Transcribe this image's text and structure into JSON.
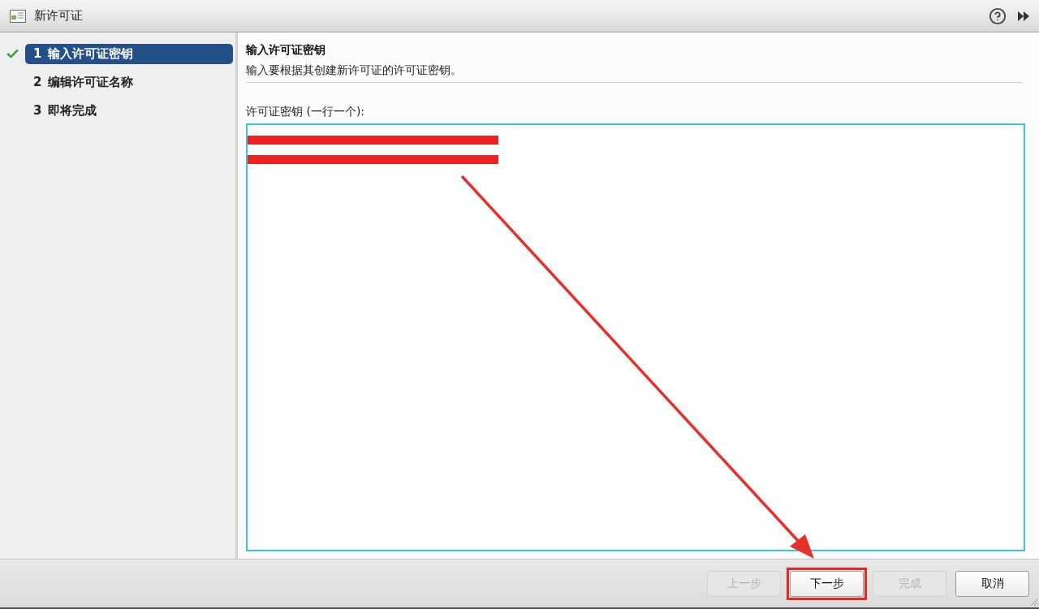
{
  "window": {
    "title": "新许可证"
  },
  "steps": [
    {
      "number": "1",
      "label": "输入许可证密钥",
      "selected": true,
      "checked": true
    },
    {
      "number": "2",
      "label": "编辑许可证名称",
      "selected": false,
      "checked": false
    },
    {
      "number": "3",
      "label": "即将完成",
      "selected": false,
      "checked": false
    }
  ],
  "page": {
    "heading": "输入许可证密钥",
    "description": "输入要根据其创建新许可证的许可证密钥。"
  },
  "license_keys": {
    "label": "许可证密钥 (一行一个):",
    "lines": [
      {
        "redacted": true
      },
      {
        "redacted": true
      }
    ]
  },
  "buttons": [
    {
      "label": "上一步",
      "disabled": true,
      "highlighted": false
    },
    {
      "label": "下一步",
      "disabled": false,
      "highlighted": true
    },
    {
      "label": "完成",
      "disabled": true,
      "highlighted": false
    },
    {
      "label": "取消",
      "disabled": false,
      "highlighted": false
    }
  ],
  "overlays": [
    {
      "kind": "arrow"
    }
  ]
}
